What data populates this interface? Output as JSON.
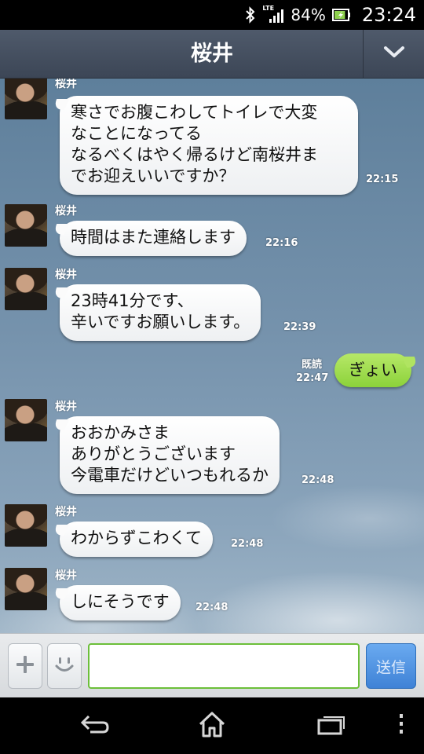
{
  "status_bar": {
    "network": "LTE",
    "battery_percent": "84%",
    "battery_level": 0.84,
    "time": "23:24",
    "icons": [
      "bluetooth-icon",
      "signal-icon",
      "battery-icon"
    ]
  },
  "header": {
    "title": "桜井",
    "collapse_icon": "chevron-down-icon"
  },
  "messages": [
    {
      "from": "桜井",
      "direction": "in",
      "lines": [
        "寒さでお腹こわしてトイレで大変",
        "なことになってる",
        "なるべくはやく帰るけど南桜井ま",
        "でお迎えいいですか？"
      ],
      "time": "22:15"
    },
    {
      "from": "桜井",
      "direction": "in",
      "lines": [
        "時間はまた連絡します"
      ],
      "time": "22:16"
    },
    {
      "from": "桜井",
      "direction": "in",
      "lines": [
        "23時41分です、",
        "辛いですお願いします。"
      ],
      "time": "22:39"
    },
    {
      "direction": "out",
      "lines": [
        "ぎょい"
      ],
      "read_label": "既読",
      "time": "22:47"
    },
    {
      "from": "桜井",
      "direction": "in",
      "lines": [
        "おおかみさま",
        "ありがとうございます",
        "今電車だけどいつもれるか"
      ],
      "time": "22:48"
    },
    {
      "from": "桜井",
      "direction": "in",
      "lines": [
        "わからずこわくて"
      ],
      "time": "22:48"
    },
    {
      "from": "桜井",
      "direction": "in",
      "lines": [
        "しにそうです"
      ],
      "time": "22:48"
    }
  ],
  "input_bar": {
    "message_value": "",
    "send_label": "送信",
    "plus_icon": "plus-icon",
    "emoji_icon": "smiley-icon"
  },
  "nav_bar": {
    "icons": [
      "back-icon",
      "home-icon",
      "recent-apps-icon",
      "overflow-menu-icon"
    ]
  },
  "colors": {
    "header_bg": "#465061",
    "bubble_in": "#ffffff",
    "bubble_out": "#a6df52",
    "send_button": "#4f91e0",
    "input_border": "#6cbf3a"
  }
}
